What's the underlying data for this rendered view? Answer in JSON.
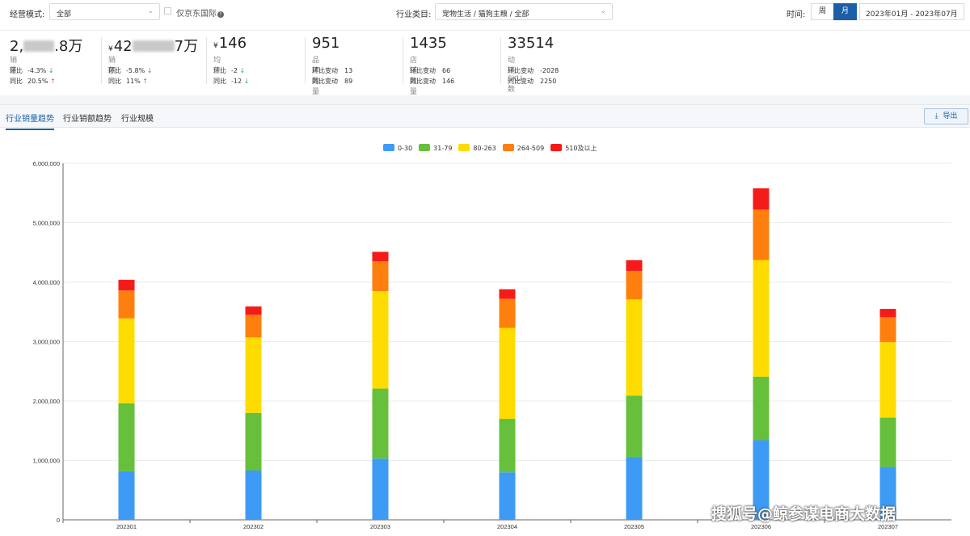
{
  "filters": {
    "mode_label": "经营模式:",
    "mode_value": "全部",
    "jd_intl_label": "仅京东国际",
    "jd_intl_info_icon": "info-icon",
    "industry_label": "行业类目:",
    "industry_value": "宠物生活 / 猫狗主粮 / 全部",
    "time_label": "时间:",
    "period_week": "周",
    "period_month": "月",
    "period_selected": "月",
    "date_range": "2023年01月 - 2023年07月"
  },
  "kpis": [
    {
      "value_prefix": "2,",
      "value_suffix": ".8万",
      "name": "销量",
      "row1_label": "环比",
      "row1_value": "-4.3%",
      "row1_trend": "down",
      "row2_label": "同比",
      "row2_value": "20.5%",
      "row2_trend": "up"
    },
    {
      "currency": "¥",
      "value_prefix": "42",
      "value_suffix": "7万",
      "name": "销额",
      "row1_label": "环比",
      "row1_value": "-5.8%",
      "row1_trend": "down",
      "row2_label": "同比",
      "row2_value": "11%",
      "row2_trend": "up"
    },
    {
      "currency": "¥",
      "value_prefix": "146",
      "value_suffix": "",
      "name": "均价",
      "row1_label": "环比",
      "row1_value": "-2",
      "row1_trend": "down",
      "row2_label": "同比",
      "row2_value": "-12",
      "row2_trend": "down"
    },
    {
      "value_prefix": "951",
      "value_suffix": "",
      "name": "品牌数量",
      "row1_label": "环比变动",
      "row1_value": "13",
      "row2_label": "同比变动",
      "row2_value": "89"
    },
    {
      "value_prefix": "1435",
      "value_suffix": "",
      "name": "店铺数量",
      "row1_label": "环比变动",
      "row1_value": "66",
      "row2_label": "同比变动",
      "row2_value": "146"
    },
    {
      "value_prefix": "33514",
      "value_suffix": "",
      "name": "动销SKU数",
      "row1_label": "环比变动",
      "row1_value": "-2028",
      "row2_label": "同比变动",
      "row2_value": "2250"
    }
  ],
  "tabs": [
    "行业销量趋势",
    "行业销额趋势",
    "行业规模"
  ],
  "active_tab": 0,
  "export_label": "导出",
  "export_icon": "download-icon",
  "colors": {
    "accent": "#1c5fa8"
  },
  "chart_data": {
    "type": "bar",
    "stacked": true,
    "categories": [
      "202301",
      "202302",
      "202303",
      "202304",
      "202305",
      "202306",
      "202307"
    ],
    "series": [
      {
        "name": "0-30",
        "color": "#3d9bf5",
        "values": [
          820000,
          830000,
          1030000,
          800000,
          1060000,
          1340000,
          890000
        ]
      },
      {
        "name": "31-79",
        "color": "#66c03b",
        "values": [
          1140000,
          970000,
          1180000,
          900000,
          1030000,
          1070000,
          830000
        ]
      },
      {
        "name": "80-263",
        "color": "#ffdc00",
        "values": [
          1430000,
          1270000,
          1640000,
          1530000,
          1620000,
          1960000,
          1270000
        ]
      },
      {
        "name": "264-509",
        "color": "#ff7f0e",
        "values": [
          470000,
          380000,
          500000,
          490000,
          480000,
          850000,
          420000
        ]
      },
      {
        "name": "510及以上",
        "color": "#f51b1b",
        "values": [
          180000,
          140000,
          160000,
          160000,
          180000,
          360000,
          140000
        ]
      }
    ],
    "ylim": [
      0,
      6000000
    ],
    "yticks": [
      0,
      1000000,
      2000000,
      3000000,
      4000000,
      5000000,
      6000000
    ],
    "ytick_labels": [
      "0",
      "1,000,000",
      "2,000,000",
      "3,000,000",
      "4,000,000",
      "5,000,000",
      "6,000,000"
    ],
    "grid": true,
    "legend_position": "top-center"
  },
  "watermark": "搜狐号@鲸参谋电商大数据"
}
